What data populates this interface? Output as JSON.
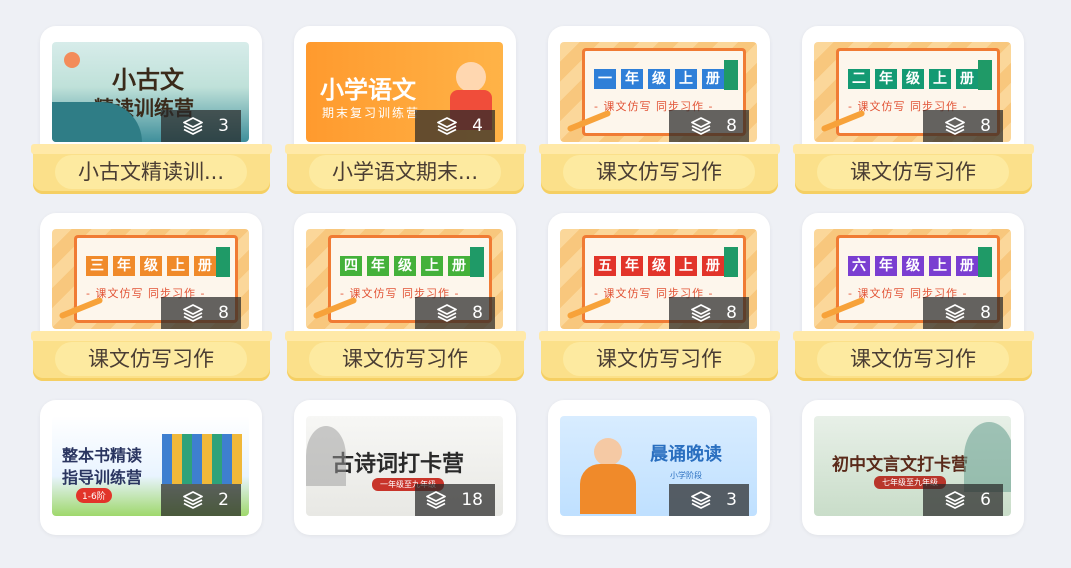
{
  "colors": {
    "background": "#eef0f5",
    "shelf": "#fbe08a",
    "label_text": "#4a3d33"
  },
  "cards": [
    {
      "label": "小古文精读训...",
      "count": "3",
      "thumb_text": [
        "小古文",
        "精读训练营"
      ]
    },
    {
      "label": "小学语文期末...",
      "count": "4",
      "thumb_text": [
        "小学语文",
        "期末复习训练营"
      ]
    },
    {
      "label": "课文仿写习作",
      "count": "8",
      "grade": [
        "一",
        "年",
        "级",
        "上",
        "册"
      ],
      "subtitle": "- 课文仿写  同步习作 -",
      "grade_colors": [
        "#2f7fd8",
        "#2f7fd8",
        "#2f7fd8",
        "#2f7fd8",
        "#2f7fd8"
      ]
    },
    {
      "label": "课文仿写习作",
      "count": "8",
      "grade": [
        "二",
        "年",
        "级",
        "上",
        "册"
      ],
      "subtitle": "- 课文仿写  同步习作 -",
      "grade_colors": [
        "#149a73",
        "#149a73",
        "#149a73",
        "#149a73",
        "#149a73"
      ]
    },
    {
      "label": "课文仿写习作",
      "count": "8",
      "grade": [
        "三",
        "年",
        "级",
        "上",
        "册"
      ],
      "subtitle": "- 课文仿写  同步习作 -",
      "grade_colors": [
        "#f08a2a",
        "#f08a2a",
        "#f08a2a",
        "#f08a2a",
        "#f08a2a"
      ]
    },
    {
      "label": "课文仿写习作",
      "count": "8",
      "grade": [
        "四",
        "年",
        "级",
        "上",
        "册"
      ],
      "subtitle": "- 课文仿写  同步习作 -",
      "grade_colors": [
        "#44b13a",
        "#44b13a",
        "#44b13a",
        "#44b13a",
        "#44b13a"
      ]
    },
    {
      "label": "课文仿写习作",
      "count": "8",
      "grade": [
        "五",
        "年",
        "级",
        "上",
        "册"
      ],
      "subtitle": "- 课文仿写  同步习作 -",
      "grade_colors": [
        "#e2342a",
        "#e2342a",
        "#e2342a",
        "#e2342a",
        "#e2342a"
      ]
    },
    {
      "label": "课文仿写习作",
      "count": "8",
      "grade": [
        "六",
        "年",
        "级",
        "上",
        "册"
      ],
      "subtitle": "- 课文仿写  同步习作 -",
      "grade_colors": [
        "#7a3ed1",
        "#7a3ed1",
        "#7a3ed1",
        "#7a3ed1",
        "#7a3ed1"
      ]
    },
    {
      "count": "2",
      "thumb_text": [
        "整本书精读",
        "指导训练营",
        "1-6阶"
      ]
    },
    {
      "count": "18",
      "thumb_text": [
        "古诗词打卡营",
        "一年级至九年级"
      ]
    },
    {
      "count": "3",
      "thumb_text": [
        "晨诵晚读",
        "小学阶段"
      ]
    },
    {
      "count": "6",
      "thumb_text": [
        "初中文言文打卡营",
        "七年级至九年级"
      ]
    }
  ]
}
